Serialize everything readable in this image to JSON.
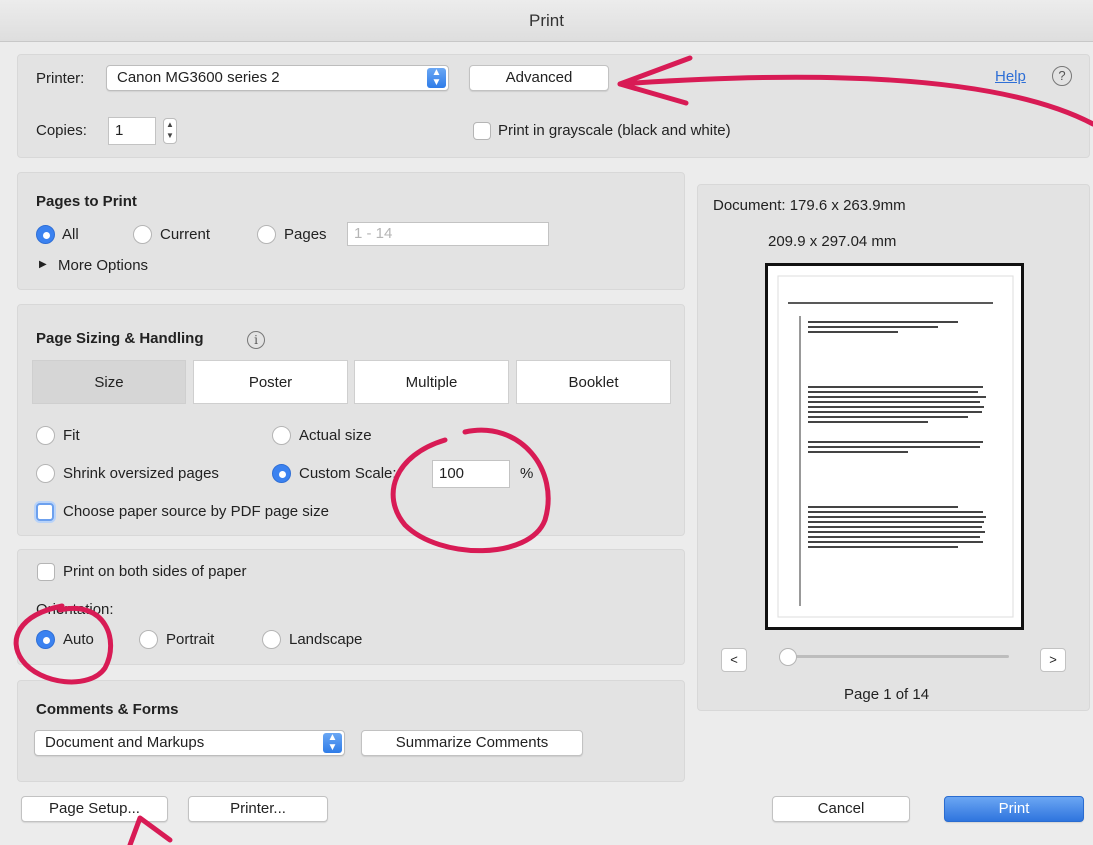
{
  "window": {
    "title": "Print"
  },
  "printer_section": {
    "printer_label": "Printer:",
    "printer_value": "Canon MG3600 series 2",
    "advanced_label": "Advanced",
    "help_label": "Help",
    "help_icon": "?",
    "copies_label": "Copies:",
    "copies_value": "1",
    "grayscale_label": "Print in grayscale (black and white)"
  },
  "pages_to_print": {
    "heading": "Pages to Print",
    "options": [
      "All",
      "Current",
      "Pages"
    ],
    "selected": "All",
    "pages_placeholder": "1 - 14",
    "more_options": "More Options",
    "more_options_icon": "▶"
  },
  "sizing": {
    "heading": "Page Sizing & Handling",
    "info_icon": "i",
    "tabs": [
      "Size",
      "Poster",
      "Multiple",
      "Booklet"
    ],
    "selected_tab": "Size",
    "fit_label": "Fit",
    "actual_size_label": "Actual size",
    "shrink_label": "Shrink oversized pages",
    "custom_scale_label": "Custom Scale:",
    "scale_value": "100",
    "percent": "%",
    "paper_source_label": "Choose paper source by PDF page size",
    "selected_option": "Custom Scale"
  },
  "orientation": {
    "both_sides_label": "Print on both sides of paper",
    "heading": "Orientation:",
    "options": [
      "Auto",
      "Portrait",
      "Landscape"
    ],
    "selected": "Auto"
  },
  "comments": {
    "heading": "Comments & Forms",
    "value": "Document and Markups",
    "summarize_label": "Summarize Comments"
  },
  "preview": {
    "document_size": "Document: 179.6 x 263.9mm",
    "paper_size": "209.9 x 297.04 mm",
    "page_indicator": "Page 1 of 14",
    "prev": "<",
    "next": ">",
    "slider_fraction": 0
  },
  "footer": {
    "page_setup": "Page Setup...",
    "printer": "Printer...",
    "cancel": "Cancel",
    "print": "Print"
  },
  "colors": {
    "accent": "#3b82f0",
    "annotation": "#d81b55"
  }
}
